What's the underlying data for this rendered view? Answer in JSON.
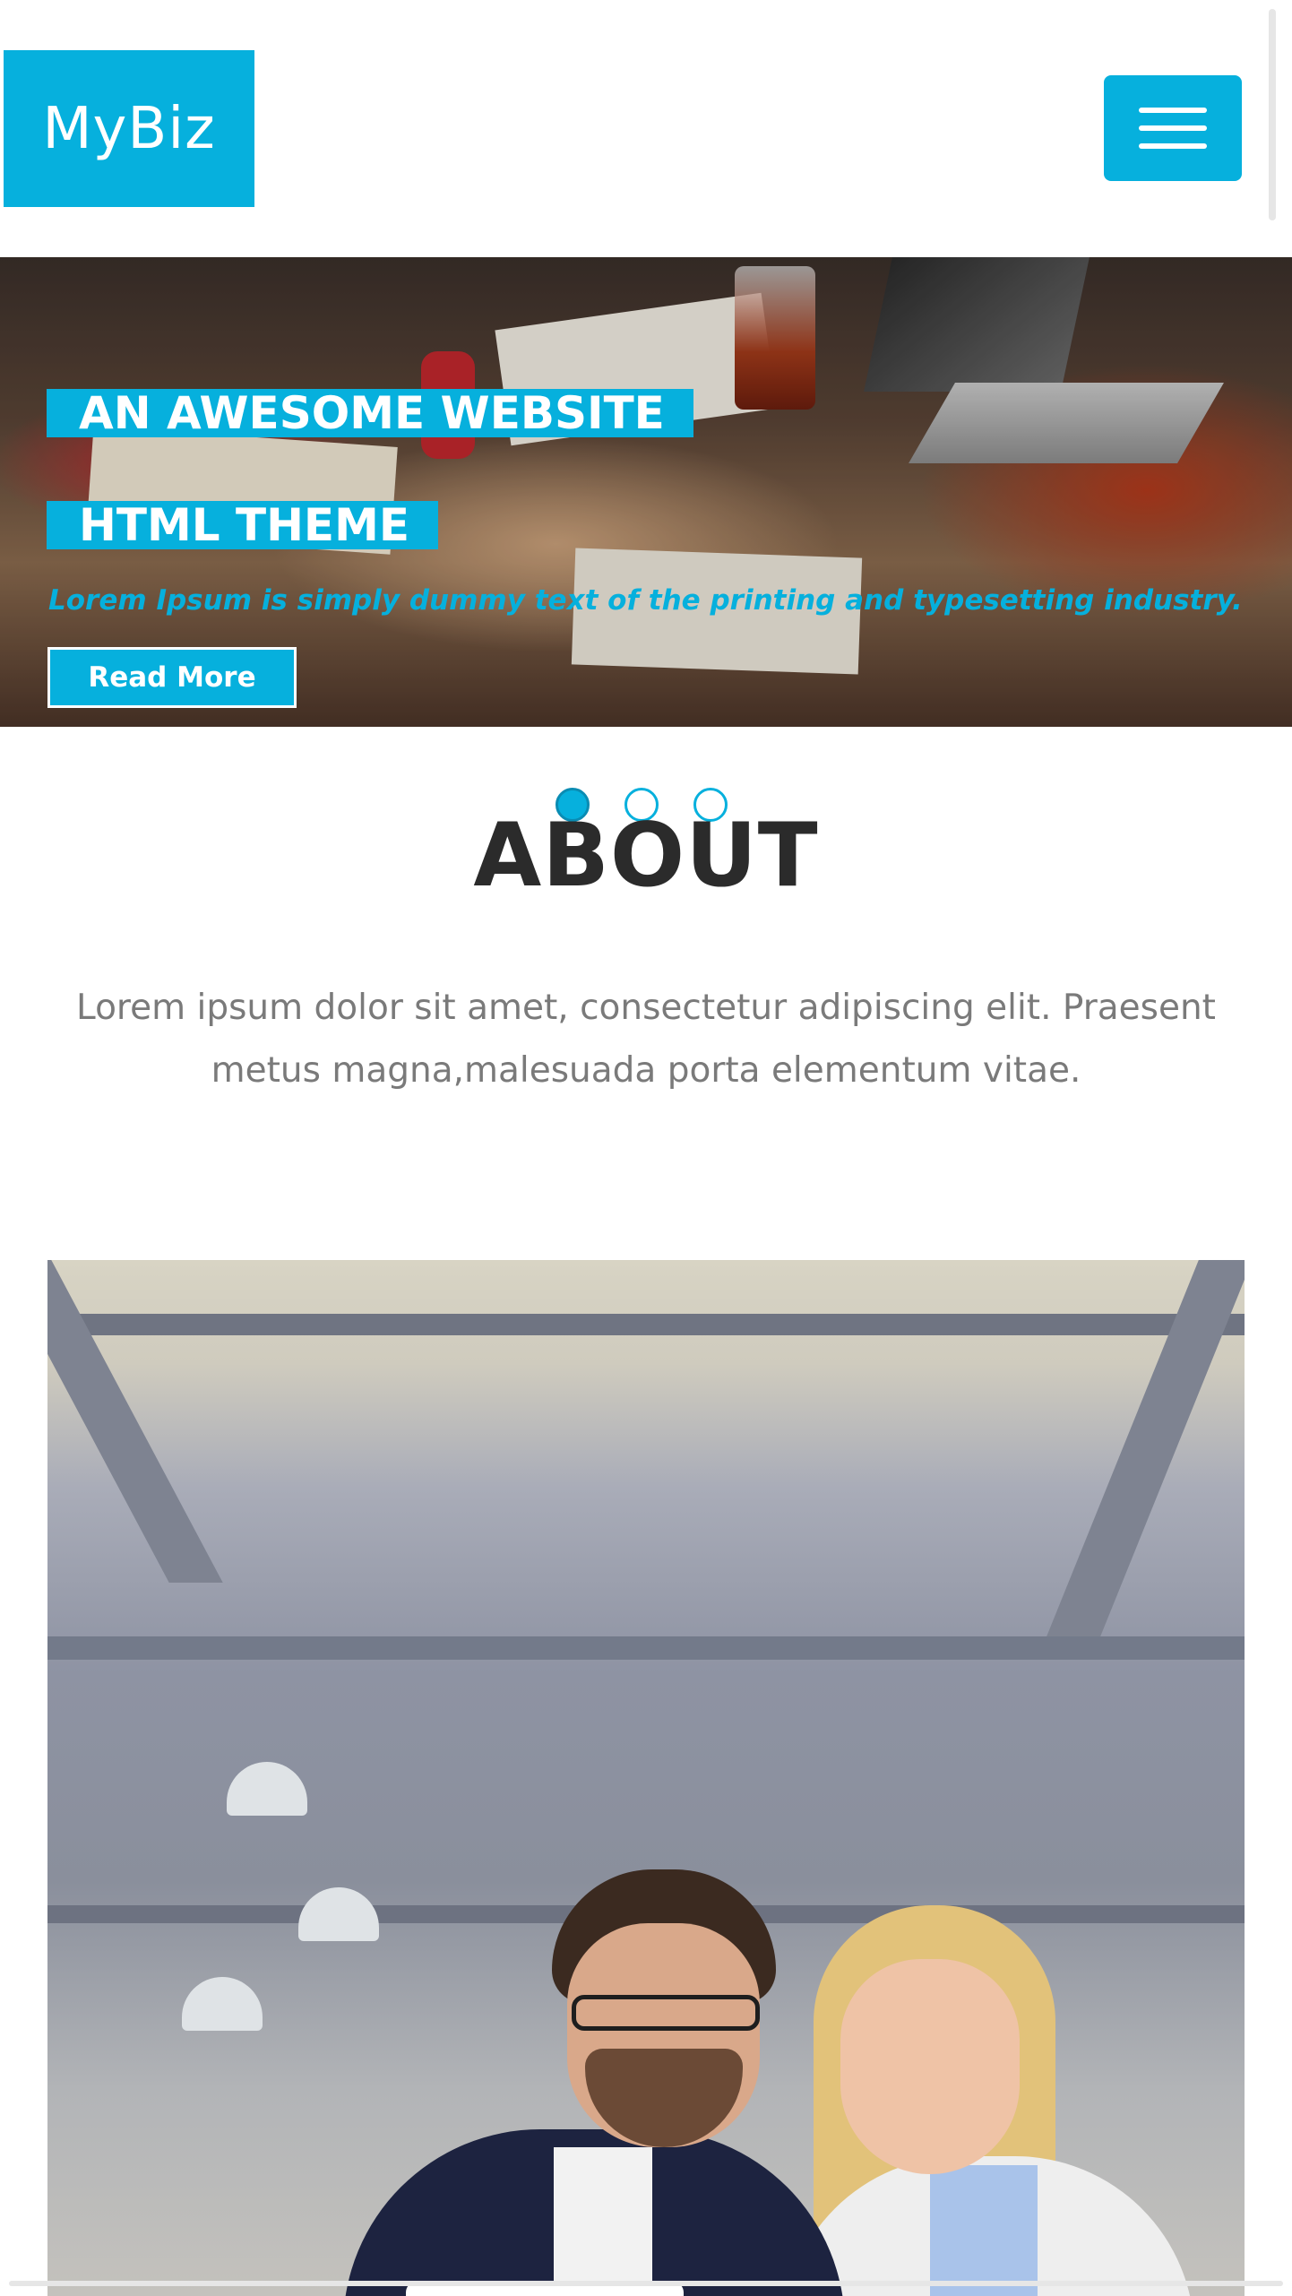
{
  "header": {
    "logo_text": "MyBiz",
    "menu_icon": "hamburger-menu-icon"
  },
  "hero": {
    "title_line1": "AN AWESOME WEBSITE",
    "title_line2": "HTML THEME",
    "subtitle": "Lorem Ipsum is simply dummy text of the printing and typesetting industry.",
    "button_label": "Read More",
    "slide_count": 3,
    "active_slide": 1
  },
  "about": {
    "title": "ABOUT",
    "text": "Lorem ipsum dolor sit amet, consectetur adipiscing elit. Praesent metus magna,malesuada porta elementum vitae."
  },
  "colors": {
    "accent": "#06b0dd",
    "heading": "#2b2b2b",
    "body_text": "#7a7a7a",
    "background": "#ffffff"
  }
}
